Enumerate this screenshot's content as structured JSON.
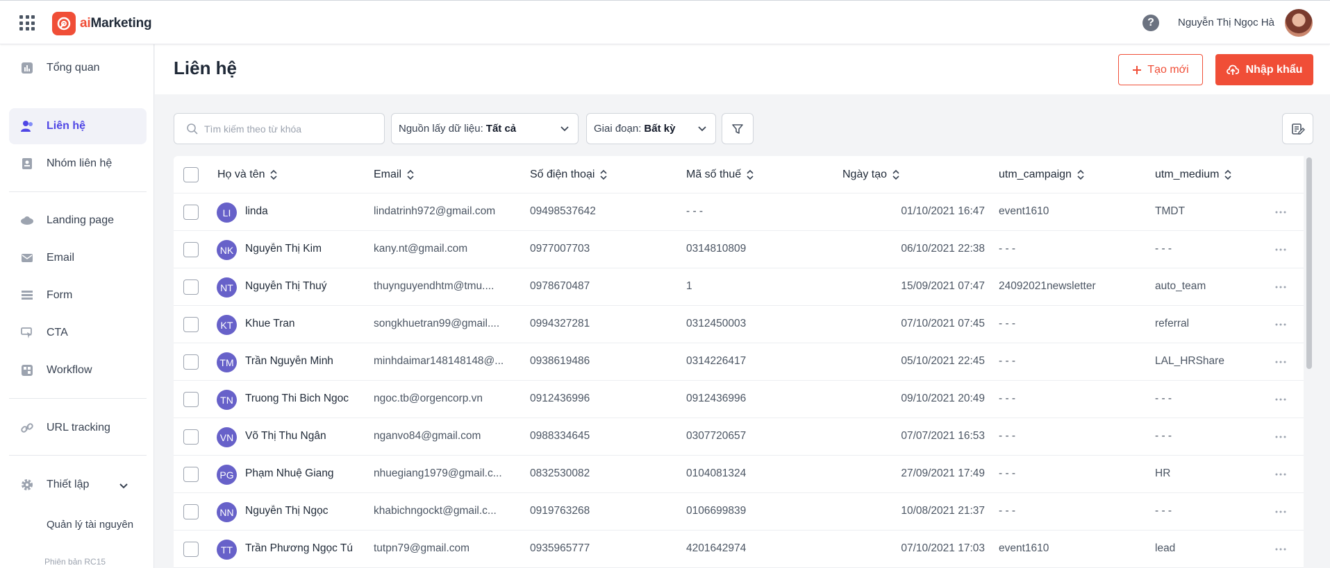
{
  "app": {
    "name_prefix": "ai",
    "name_suffix": "Marketing"
  },
  "user": {
    "name": "Nguyễn Thị Ngọc Hà"
  },
  "sidebar": {
    "items": [
      {
        "label": "Tổng quan",
        "icon": "chart-icon"
      },
      {
        "label": "Liên hệ",
        "icon": "contacts-icon",
        "active": true
      },
      {
        "label": "Nhóm liên hệ",
        "icon": "contact-group-icon"
      },
      {
        "label": "Landing page",
        "icon": "landing-page-icon"
      },
      {
        "label": "Email",
        "icon": "email-icon"
      },
      {
        "label": "Form",
        "icon": "form-icon"
      },
      {
        "label": "CTA",
        "icon": "cta-icon"
      },
      {
        "label": "Workflow",
        "icon": "workflow-icon"
      },
      {
        "label": "URL tracking",
        "icon": "link-icon"
      },
      {
        "label": "Thiết lập",
        "icon": "gear-icon"
      }
    ],
    "sub_item": "Quản lý tài nguyên",
    "version": "Phiên bản RC15"
  },
  "page": {
    "title": "Liên hệ",
    "create_label": "Tạo mới",
    "import_label": "Nhập khẩu"
  },
  "filters": {
    "search_placeholder": "Tìm kiếm theo từ khóa",
    "source_label": "Nguồn lấy dữ liệu:",
    "source_value": "Tất cả",
    "stage_label": "Giai đoạn:",
    "stage_value": "Bất kỳ"
  },
  "table": {
    "columns": [
      "Họ và tên",
      "Email",
      "Số điện thoại",
      "Mã số thuế",
      "Ngày tạo",
      "utm_campaign",
      "utm_medium"
    ],
    "rows": [
      {
        "initials": "LI",
        "name": "linda",
        "email": "lindatrinh972@gmail.com",
        "phone": "09498537642",
        "tax": "- - -",
        "created": "01/10/2021 16:47",
        "campaign": "event1610",
        "medium": "TMDT"
      },
      {
        "initials": "NK",
        "name": "Nguyễn Thị Kim",
        "email": "kany.nt@gmail.com",
        "phone": "0977007703",
        "tax": "0314810809",
        "created": "06/10/2021 22:38",
        "campaign": "- - -",
        "medium": "- - -"
      },
      {
        "initials": "NT",
        "name": "Nguyễn Thị Thuý",
        "email": "thuynguyendhtm@tmu....",
        "phone": "0978670487",
        "tax": "1",
        "created": "15/09/2021 07:47",
        "campaign": "24092021newsletter",
        "medium": "auto_team"
      },
      {
        "initials": "KT",
        "name": "Khue Tran",
        "email": "songkhuetran99@gmail....",
        "phone": "0994327281",
        "tax": "0312450003",
        "created": "07/10/2021 07:45",
        "campaign": "- - -",
        "medium": "referral"
      },
      {
        "initials": "TM",
        "name": "Trần Nguyễn Minh",
        "email": "minhdaimar148148148@...",
        "phone": "0938619486",
        "tax": "0314226417",
        "created": "05/10/2021 22:45",
        "campaign": "- - -",
        "medium": "LAL_HRShare"
      },
      {
        "initials": "TN",
        "name": "Truong Thi Bich Ngoc",
        "email": "ngoc.tb@orgencorp.vn",
        "phone": "0912436996",
        "tax": "0912436996",
        "created": "09/10/2021 20:49",
        "campaign": "- - -",
        "medium": "- - -"
      },
      {
        "initials": "VN",
        "name": "Võ Thị Thu Ngân",
        "email": "nganvo84@gmail.com",
        "phone": "0988334645",
        "tax": "0307720657",
        "created": "07/07/2021 16:53",
        "campaign": "- - -",
        "medium": "- - -"
      },
      {
        "initials": "PG",
        "name": "Phạm Nhuệ Giang",
        "email": "nhuegiang1979@gmail.c...",
        "phone": "0832530082",
        "tax": "0104081324",
        "created": "27/09/2021 17:49",
        "campaign": "- - -",
        "medium": "HR"
      },
      {
        "initials": "NN",
        "name": "Nguyễn Thị Ngọc",
        "email": "khabichngockt@gmail.c...",
        "phone": "0919763268",
        "tax": "0106699839",
        "created": "10/08/2021 21:37",
        "campaign": "- - -",
        "medium": "- - -"
      },
      {
        "initials": "TT",
        "name": "Trần Phương Ngọc Tú",
        "email": "tutpn79@gmail.com",
        "phone": "0935965777",
        "tax": "4201642974",
        "created": "07/10/2021 17:03",
        "campaign": "event1610",
        "medium": "lead"
      }
    ]
  },
  "colors": {
    "brand": "#f04e37",
    "accent": "#4f46e5",
    "avatar": "#6761c9"
  }
}
